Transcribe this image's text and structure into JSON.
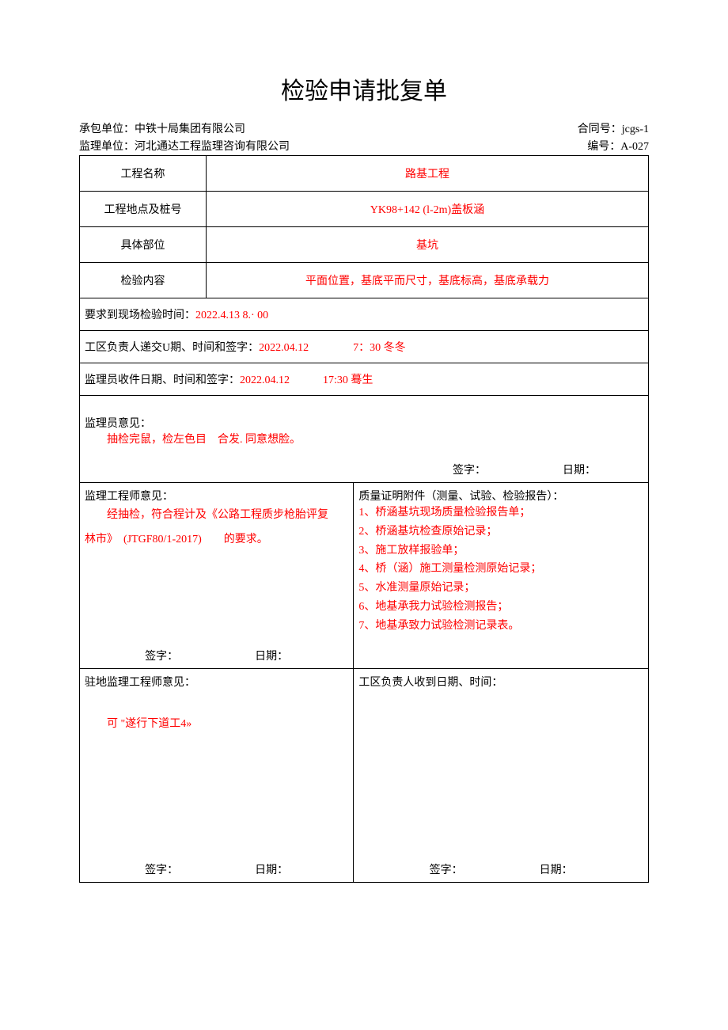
{
  "title": "检验申请批复单",
  "header": {
    "contractor_label": "承包单位：",
    "contractor_value": "中铁十局集团有限公司",
    "contract_no_label": "合同号：",
    "contract_no_value": "jcgs-1",
    "supervisor_label": "监理单位：",
    "supervisor_value": "河北通达工程监理咨询有限公司",
    "serial_no_label": "编号：",
    "serial_no_value": "A-027"
  },
  "rows": {
    "project_name_label": "工程名称",
    "project_name_value": "路基工程",
    "location_label": "工程地点及桩号",
    "location_value": "YK98+142 (l-2m)盖板涵",
    "part_label": "具体部位",
    "part_value": "基坑",
    "content_label": "检验内容",
    "content_value": "平面位置，基底平而尺寸，基底标高，基底承载力",
    "require_time_label": "要求到现场检验时间：",
    "require_time_value": "2022.4.13 8.· 00",
    "submit_label": "工区负责人递交U期、时间和签字：",
    "submit_value": "2022.04.12　　　　7：30 冬冬",
    "receive_label": "监理员收件日期、时间和签字：",
    "receive_value": "2022.04.12　　　17:30 蓦生"
  },
  "opinions": {
    "supervisor_opinion_label": "监理员意见：",
    "supervisor_opinion_text": "抽检完鼠，检左色目　合发. 同意想脸。",
    "sign_label": "签字：",
    "date_label": "日期：",
    "engineer_opinion_label": "监理工程师意见：",
    "engineer_opinion_line1": "经抽检，符合程计及《公路工程质步枪胎评复",
    "engineer_opinion_line2_a": "林市》　(JTGF80/1-2017)　　的要求。",
    "attachments_label": "质量证明附件（测量、试验、检验报告）：",
    "attachments": [
      "1、桥涵基坑现场质量检验报告单；",
      "2、桥涵基坑检查原始记录；",
      "3、施工放样报验单；",
      "4、桥（涵）施工测量检测原始记录；",
      "5、水准测量原始记录；",
      "6、地基承我力试验检测报告；",
      "7、地基承致力试验检测记录表。"
    ],
    "resident_label": "驻地监理工程师意见：",
    "resident_text": "可 \"遂行下道工4»",
    "receiver_label": "工区负责人收到日期、时间："
  }
}
